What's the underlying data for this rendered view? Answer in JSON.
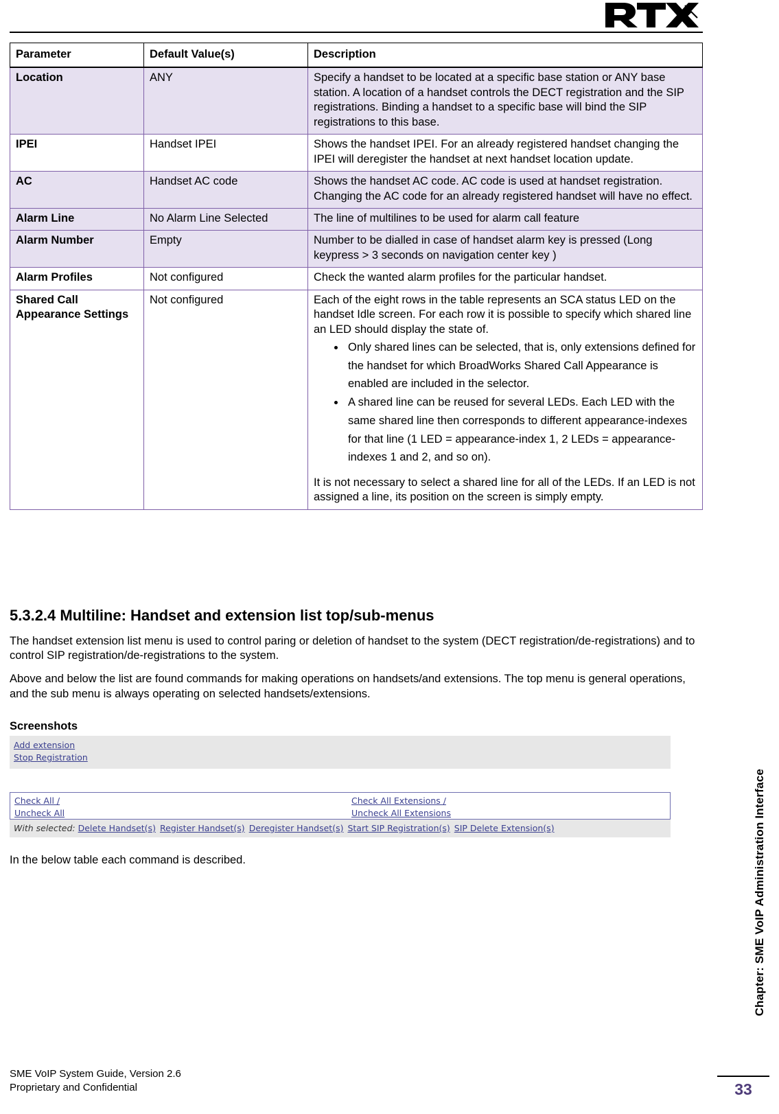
{
  "header": {
    "logo_text": "RTX"
  },
  "table": {
    "columns": [
      "Parameter",
      "Default Value(s)",
      "Description"
    ],
    "rows": [
      {
        "parameter": "Location",
        "default": "ANY",
        "description": "Specify a handset to be located at a specific base station or ANY base station. A location of a handset controls the DECT registration and the SIP registrations. Binding a handset to a specific base will bind the SIP registrations to this base."
      },
      {
        "parameter": "IPEI",
        "default": "Handset IPEI",
        "description": "Shows the handset IPEI. For an already registered handset changing the IPEI will deregister the handset at next handset location update."
      },
      {
        "parameter": "AC",
        "default": "Handset AC code",
        "description": "Shows the handset AC code. AC code is used at handset registration. Changing the AC code for an already registered handset will have no effect."
      },
      {
        "parameter": "Alarm Line",
        "default": "No Alarm Line Selected",
        "description": "The line of multilines to be used for alarm call feature"
      },
      {
        "parameter": "Alarm Number",
        "default": "Empty",
        "description": "Number to be dialled in case of handset alarm key is pressed (Long keypress > 3 seconds on navigation center key )"
      },
      {
        "parameter": "Alarm Profiles",
        "default": "Not configured",
        "description": "Check the wanted alarm profiles for the particular handset."
      },
      {
        "parameter": "Shared Call Appearance Settings",
        "default": "Not configured",
        "description": "Each of the eight rows in the table represents an SCA status LED on the handset Idle screen. For each row it is possible to specify which shared line an LED should display the state of.",
        "bullets": [
          "Only shared lines can be selected, that is, only extensions defined for the handset for which BroadWorks Shared Call Appearance is enabled are included in the selector.",
          "A shared line can be reused for several LEDs. Each LED with the same shared line then corresponds to different appearance-indexes for that line (1 LED = appearance-index 1, 2 LEDs = appearance-indexes 1 and 2, and so on)."
        ],
        "after_bullets": "It is not necessary to select a shared line for all of the LEDs. If an LED is not assigned a line, its position on the screen is simply empty."
      }
    ]
  },
  "section": {
    "heading": "5.3.2.4 Multiline: Handset and extension list top/sub-menus",
    "paragraph1": "The handset extension list menu is used to control paring or deletion of handset to the system (DECT registration/de-registrations) and to control SIP registration/de-registrations to the system.",
    "paragraph2": "Above and below the list are found commands for making operations on handsets/and extensions. The top menu is general operations, and the sub menu is always operating on selected handsets/extensions.",
    "screenshots_label": "Screenshots",
    "below_note": "In the below table each command is described."
  },
  "screenshot": {
    "top_links": [
      "Add extension",
      "Stop Registration"
    ],
    "check_all_left_line1": "Check All /",
    "check_all_left_line2": "Uncheck All",
    "check_all_right_line1": "Check All Extensions /",
    "check_all_right_line2": "Uncheck All Extensions",
    "with_selected_label": "With selected:",
    "actions": [
      "Delete Handset(s)",
      "Register Handset(s)",
      "Deregister Handset(s)",
      "Start SIP Registration(s)",
      "SIP Delete Extension(s)"
    ]
  },
  "side_chapter": "Chapter: SME VoIP Administration Interface",
  "footer": {
    "line1": "SME VoIP System Guide, Version 2.6",
    "line2": "Proprietary and Confidential",
    "page_number": "33"
  }
}
